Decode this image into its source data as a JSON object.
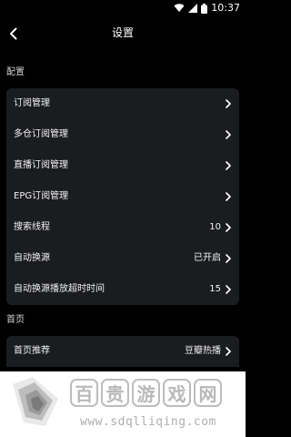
{
  "status_bar": {
    "time": "10:37"
  },
  "header": {
    "title": "设置"
  },
  "sections": {
    "config": {
      "label": "配置",
      "items": [
        {
          "label": "订阅管理",
          "value": ""
        },
        {
          "label": "多仓订阅管理",
          "value": ""
        },
        {
          "label": "直播订阅管理",
          "value": ""
        },
        {
          "label": "EPG订阅管理",
          "value": ""
        },
        {
          "label": "搜索线程",
          "value": "10"
        },
        {
          "label": "自动换源",
          "value": "已开启"
        },
        {
          "label": "自动换源播放超时时间",
          "value": "15"
        }
      ]
    },
    "home": {
      "label": "首页",
      "items": [
        {
          "label": "首页推荐",
          "value": "豆瓣热播"
        }
      ]
    }
  },
  "watermark": {
    "chars": [
      "百",
      "贵",
      "游",
      "戏",
      "网"
    ],
    "url": "www.sdqlliqing.com"
  }
}
